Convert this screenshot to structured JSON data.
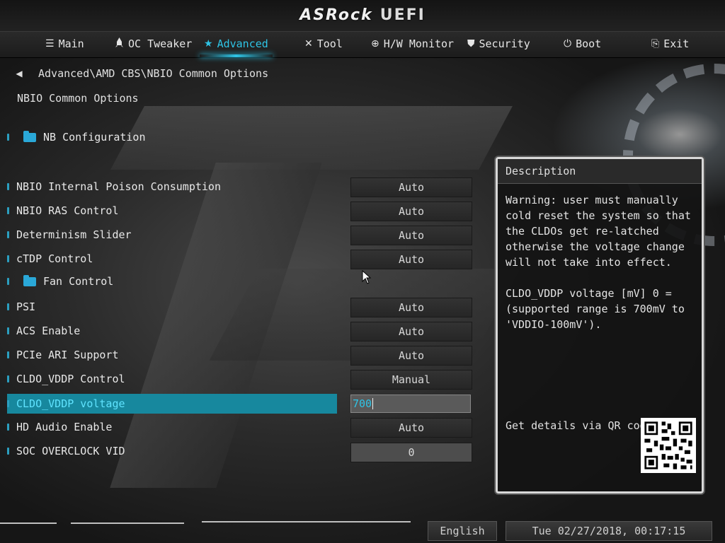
{
  "header": {
    "brand": "ASRock",
    "product": "UEFI"
  },
  "nav": {
    "tabs": [
      {
        "label": "Main",
        "icon": "list-icon",
        "glyph": "☰"
      },
      {
        "label": "OC Tweaker",
        "icon": "rocket-icon",
        "glyph": "🚀"
      },
      {
        "label": "Advanced",
        "icon": "star-icon",
        "glyph": "★"
      },
      {
        "label": "Tool",
        "icon": "tools-icon",
        "glyph": "✕"
      },
      {
        "label": "H/W Monitor",
        "icon": "monitor-icon",
        "glyph": "⊕"
      },
      {
        "label": "Security",
        "icon": "shield-icon",
        "glyph": "⛊"
      },
      {
        "label": "Boot",
        "icon": "power-icon",
        "glyph": "⏻"
      },
      {
        "label": "Exit",
        "icon": "exit-icon",
        "glyph": "⎘"
      }
    ],
    "active": "Advanced"
  },
  "breadcrumb": "Advanced\\AMD CBS\\NBIO Common Options",
  "page_title": "NBIO Common Options",
  "folders": {
    "nb_configuration": "NB Configuration",
    "fan_control": "Fan Control"
  },
  "settings": [
    {
      "label": "NBIO Internal Poison Consumption",
      "value": "Auto"
    },
    {
      "label": "NBIO RAS Control",
      "value": "Auto"
    },
    {
      "label": "Determinism Slider",
      "value": "Auto"
    },
    {
      "label": "cTDP Control",
      "value": "Auto"
    },
    {
      "label": "PSI",
      "value": "Auto"
    },
    {
      "label": "ACS Enable",
      "value": "Auto"
    },
    {
      "label": "PCIe ARI Support",
      "value": "Auto"
    },
    {
      "label": "CLDO_VDDP Control",
      "value": "Manual"
    },
    {
      "label": "CLDO_VDDP voltage",
      "value": "700"
    },
    {
      "label": "HD Audio Enable",
      "value": "Auto"
    },
    {
      "label": "SOC OVERCLOCK VID",
      "value": "0"
    }
  ],
  "description": {
    "title": "Description",
    "warning": "Warning: user must manually cold reset the system so that the CLDOs get re-latched otherwise the voltage change will not take into effect.",
    "detail": "CLDO_VDDP voltage [mV] 0 = (supported range is 700mV to 'VDDIO-100mV').",
    "qr_label": "Get details via QR code"
  },
  "footer": {
    "language": "English",
    "datetime": "Tue 02/27/2018, 00:17:15"
  }
}
